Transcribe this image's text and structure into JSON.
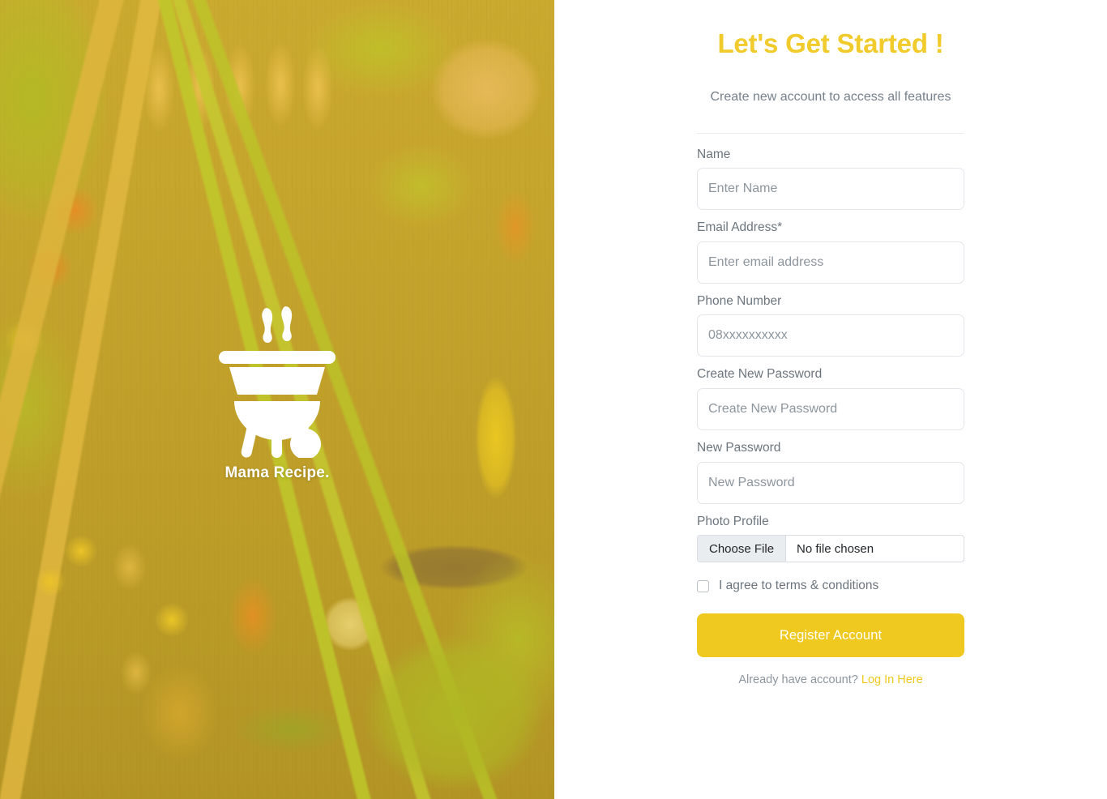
{
  "hero": {
    "logo_icon": "grill-pot-icon",
    "brand_name": "Mama Recipe.",
    "background_image": "food-ingredients-on-wooden-table-photo",
    "tint_color": "#EBC828"
  },
  "form": {
    "title": "Let's Get Started !",
    "subtitle": "Create new account to access all features",
    "fields": [
      {
        "label": "Name",
        "placeholder": "Enter Name",
        "value": "",
        "type": "text"
      },
      {
        "label": "Email Address*",
        "placeholder": "Enter email address",
        "value": "",
        "type": "email"
      },
      {
        "label": "Phone Number",
        "placeholder": "08xxxxxxxxxx",
        "value": "",
        "type": "tel"
      },
      {
        "label": "Create New Password",
        "placeholder": "Create New Password",
        "value": "",
        "type": "password"
      },
      {
        "label": "New Password",
        "placeholder": "New Password",
        "value": "",
        "type": "password"
      }
    ],
    "photo_profile": {
      "label": "Photo Profile",
      "choose_button": "Choose File",
      "file_status": "No file chosen"
    },
    "terms": {
      "label": "I agree to terms & conditions",
      "checked": false
    },
    "submit_label": "Register Account",
    "footer": {
      "text": "Already have account?",
      "link_label": "Log In Here"
    },
    "accent_color": "#EFC91F",
    "label_color": "#6C757D"
  }
}
